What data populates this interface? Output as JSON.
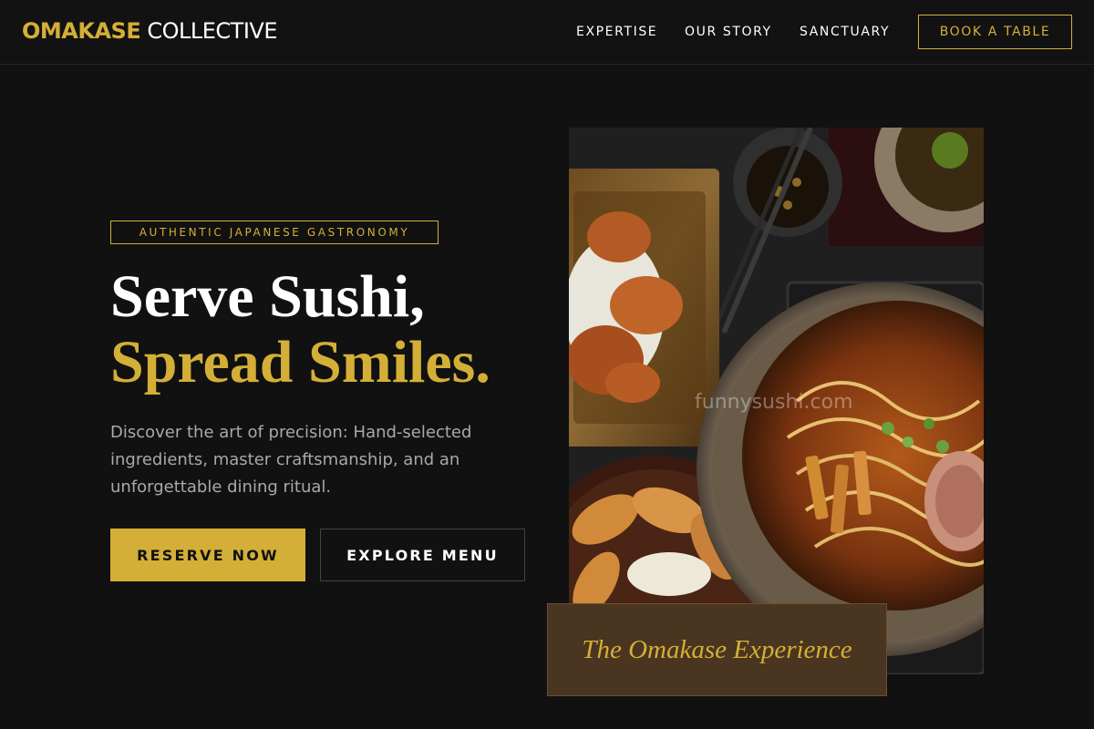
{
  "brand": {
    "primary": "OMAKASE",
    "secondary": "COLLECTIVE"
  },
  "nav": {
    "items": [
      {
        "label": "EXPERTISE"
      },
      {
        "label": "OUR STORY"
      },
      {
        "label": "SANCTUARY"
      }
    ],
    "cta_label": "BOOK A TABLE"
  },
  "hero": {
    "tag": "AUTHENTIC JAPANESE GASTRONOMY",
    "headline_line1": "Serve Sushi,",
    "headline_line2": "Spread Smiles.",
    "description": "Discover the art of precision: Hand-selected ingredients, master craftsmanship, and an unforgettable dining ritual.",
    "primary_button": "RESERVE NOW",
    "secondary_button": "EXPLORE MENU"
  },
  "media": {
    "watermark": "funnysushi.com",
    "caption": "The Omakase Experience"
  },
  "colors": {
    "accent": "#d4af37",
    "background": "#111111",
    "caption_bg": "#4a3520"
  },
  "icons": {
    "food_photo": "food-photo"
  }
}
